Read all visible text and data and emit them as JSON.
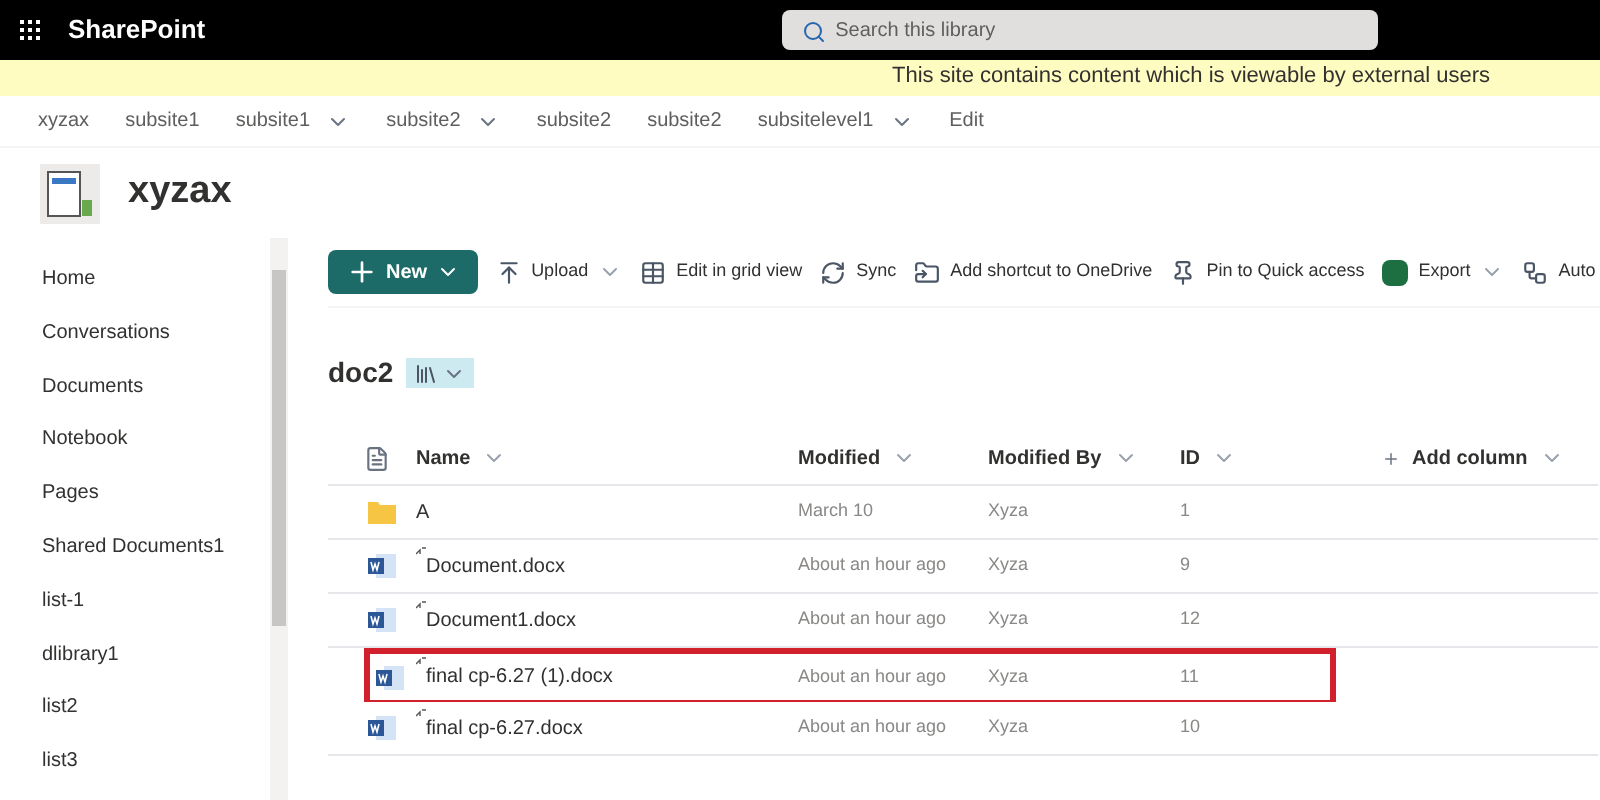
{
  "app_bar": {
    "title": "SharePoint",
    "search": {
      "placeholder": "Search this library"
    }
  },
  "banner": {
    "lines": [
      "This site contains content which is viewable by external users"
    ]
  },
  "site_nav": [
    {
      "label": "xyzax",
      "dropdown": false
    },
    {
      "label": "subsite1",
      "dropdown": false
    },
    {
      "label": "subsite1",
      "dropdown": true
    },
    {
      "label": "subsite2",
      "dropdown": true
    },
    {
      "label": "subsite2",
      "dropdown": false
    },
    {
      "label": "subsite2",
      "dropdown": false
    },
    {
      "label": "subsitelevel1",
      "dropdown": true
    },
    {
      "label": "Edit",
      "dropdown": false
    }
  ],
  "site": {
    "title": "xyzax"
  },
  "sidebar": {
    "items": [
      "Home",
      "Conversations",
      "Documents",
      "Notebook",
      "Pages",
      "Shared Documents1",
      "list-1",
      "dlibrary1",
      "list2",
      "list3"
    ]
  },
  "command_bar": [
    {
      "kind": "new",
      "label": "New",
      "dropdown": true
    },
    {
      "kind": "upload",
      "label": "Upload",
      "dropdown": true
    },
    {
      "kind": "grid",
      "label": "Edit in grid view",
      "dropdown": false
    },
    {
      "kind": "sync",
      "label": "Sync",
      "dropdown": false
    },
    {
      "kind": "shortcut",
      "label": "Add shortcut to OneDrive",
      "dropdown": false
    },
    {
      "kind": "pin",
      "label": "Pin to Quick access",
      "dropdown": false
    },
    {
      "kind": "export",
      "label": "Export",
      "dropdown": true
    },
    {
      "kind": "automate",
      "label": "Auto",
      "dropdown": false
    }
  ],
  "library": {
    "title": "doc2"
  },
  "table": {
    "columns": [
      "Name",
      "Modified",
      "Modified By",
      "ID",
      "Add column"
    ],
    "rows": [
      {
        "kind": "folder",
        "name": "A",
        "modified": "March 10",
        "modified_by": "Xyza",
        "id": "1",
        "new": false,
        "highlighted": false
      },
      {
        "kind": "word",
        "name": "Document.docx",
        "modified": "About an hour ago",
        "modified_by": "Xyza",
        "id": "9",
        "new": true,
        "highlighted": false
      },
      {
        "kind": "word",
        "name": "Document1.docx",
        "modified": "About an hour ago",
        "modified_by": "Xyza",
        "id": "12",
        "new": true,
        "highlighted": false
      },
      {
        "kind": "word",
        "name": "final cp-6.27 (1).docx",
        "modified": "About an hour ago",
        "modified_by": "Xyza",
        "id": "11",
        "new": true,
        "highlighted": true
      },
      {
        "kind": "word",
        "name": "final cp-6.27.docx",
        "modified": "About an hour ago",
        "modified_by": "Xyza",
        "id": "10",
        "new": true,
        "highlighted": false
      }
    ]
  }
}
